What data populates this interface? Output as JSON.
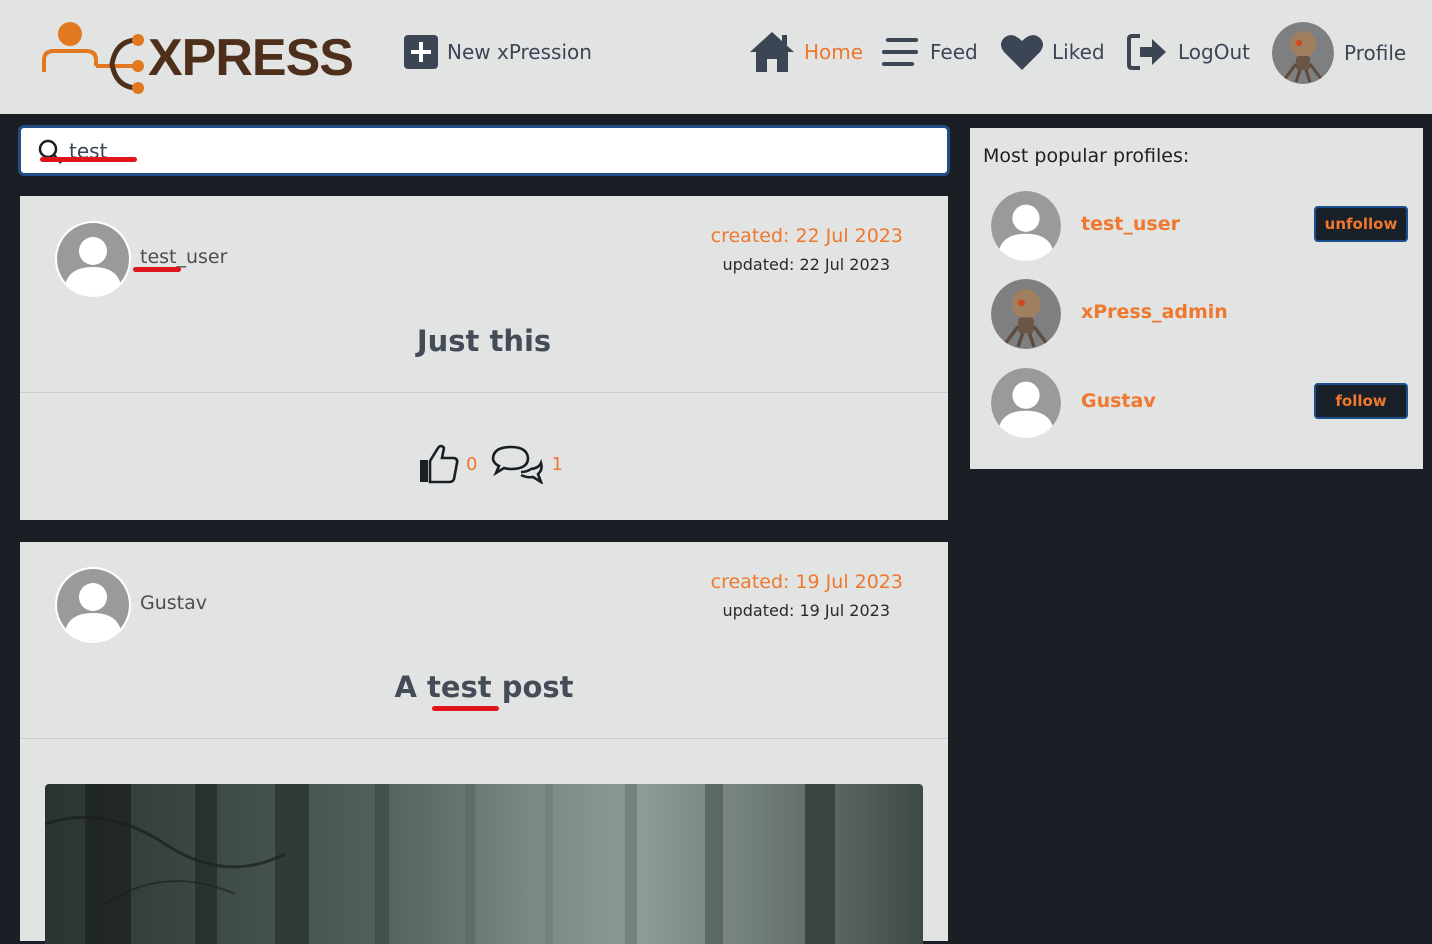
{
  "header": {
    "logo_text": "XPRESS",
    "new_label": "New xPression",
    "nav": {
      "home": "Home",
      "feed": "Feed",
      "liked": "Liked",
      "logout": "LogOut",
      "profile": "Profile"
    }
  },
  "search": {
    "value": "test",
    "placeholder": ""
  },
  "posts": [
    {
      "user": "test_user",
      "created": "created: 22 Jul 2023",
      "updated": "updated: 22 Jul 2023",
      "title": "Just this",
      "likes": "0",
      "comments": "1"
    },
    {
      "user": "Gustav",
      "created": "created: 19 Jul 2023",
      "updated": "updated: 19 Jul 2023",
      "title_prefix": "A ",
      "title_highlight": "test",
      "title_suffix": " post"
    }
  ],
  "sidebar": {
    "title": "Most popular profiles:",
    "profiles": [
      {
        "name": "test_user",
        "button": "unfollow"
      },
      {
        "name": "xPress_admin",
        "button": ""
      },
      {
        "name": "Gustav",
        "button": "follow"
      }
    ]
  },
  "colors": {
    "accent": "#f0772e",
    "header_bg": "#e2e4e3",
    "page_bg": "#1b1f25",
    "highlight": "#e0151b"
  }
}
